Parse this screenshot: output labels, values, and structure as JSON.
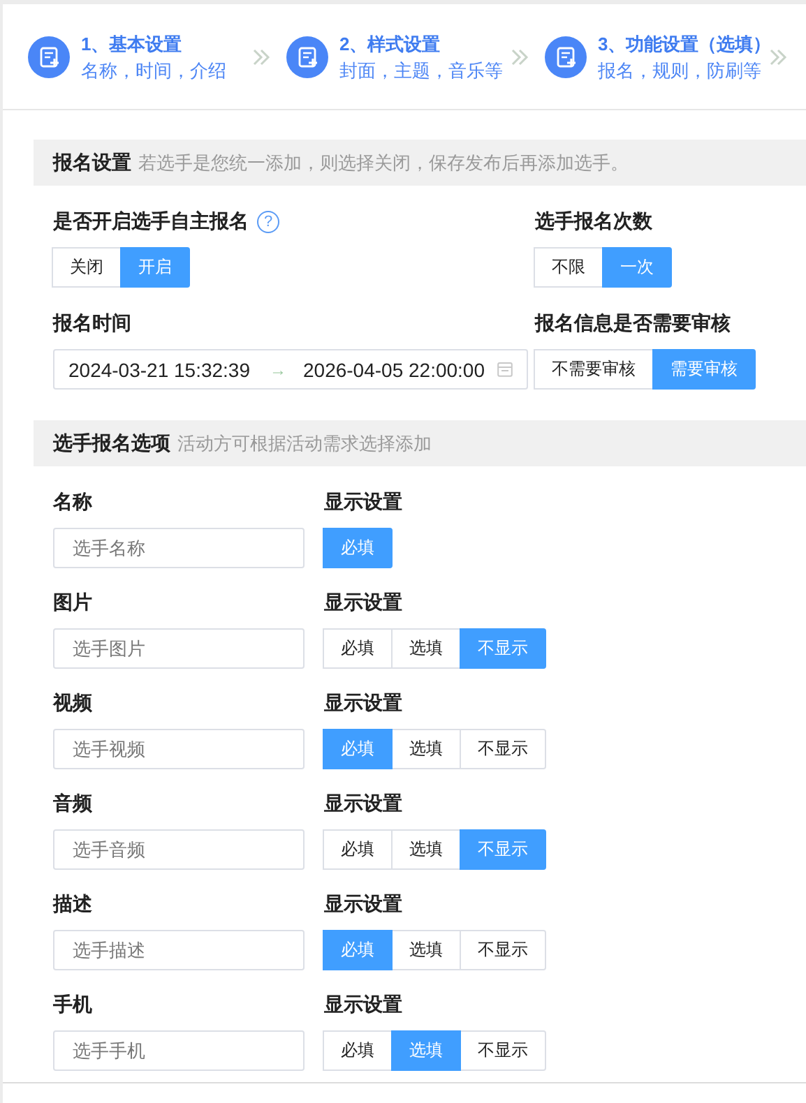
{
  "steps": [
    {
      "title": "1、基本设置",
      "subtitle": "名称，时间，介绍"
    },
    {
      "title": "2、样式设置",
      "subtitle": "封面，主题，音乐等"
    },
    {
      "title": "3、功能设置（选填）",
      "subtitle": "报名，规则，防刷等"
    }
  ],
  "signup_section": {
    "title": "报名设置",
    "hint": "若选手是您统一添加，则选择关闭，保存发布后再添加选手。",
    "self_signup": {
      "label": "是否开启选手自主报名",
      "help": "?",
      "options": [
        {
          "label": "关闭",
          "selected": false
        },
        {
          "label": "开启",
          "selected": true
        }
      ]
    },
    "signup_count": {
      "label": "选手报名次数",
      "options": [
        {
          "label": "不限",
          "selected": false
        },
        {
          "label": "一次",
          "selected": true
        }
      ]
    },
    "signup_time": {
      "label": "报名时间",
      "start": "2024-03-21 15:32:39",
      "separator": "→",
      "end": "2026-04-05 22:00:00"
    },
    "review": {
      "label": "报名信息是否需要审核",
      "options": [
        {
          "label": "不需要审核",
          "selected": false
        },
        {
          "label": "需要审核",
          "selected": true
        }
      ]
    }
  },
  "options_section": {
    "title": "选手报名选项",
    "hint": "活动方可根据活动需求选择添加",
    "items": [
      {
        "label": "名称",
        "placeholder": "选手名称",
        "display_label": "显示设置",
        "options": [
          {
            "label": "必填",
            "selected": true
          }
        ]
      },
      {
        "label": "图片",
        "placeholder": "选手图片",
        "display_label": "显示设置",
        "options": [
          {
            "label": "必填",
            "selected": false
          },
          {
            "label": "选填",
            "selected": false
          },
          {
            "label": "不显示",
            "selected": true
          }
        ]
      },
      {
        "label": "视频",
        "placeholder": "选手视频",
        "display_label": "显示设置",
        "options": [
          {
            "label": "必填",
            "selected": true
          },
          {
            "label": "选填",
            "selected": false
          },
          {
            "label": "不显示",
            "selected": false
          }
        ]
      },
      {
        "label": "音频",
        "placeholder": "选手音频",
        "display_label": "显示设置",
        "options": [
          {
            "label": "必填",
            "selected": false
          },
          {
            "label": "选填",
            "selected": false
          },
          {
            "label": "不显示",
            "selected": true
          }
        ]
      },
      {
        "label": "描述",
        "placeholder": "选手描述",
        "display_label": "显示设置",
        "options": [
          {
            "label": "必填",
            "selected": true
          },
          {
            "label": "选填",
            "selected": false
          },
          {
            "label": "不显示",
            "selected": false
          }
        ]
      },
      {
        "label": "手机",
        "placeholder": "选手手机",
        "display_label": "显示设置",
        "options": [
          {
            "label": "必填",
            "selected": false
          },
          {
            "label": "选填",
            "selected": true
          },
          {
            "label": "不显示",
            "selected": false
          }
        ]
      }
    ]
  }
}
